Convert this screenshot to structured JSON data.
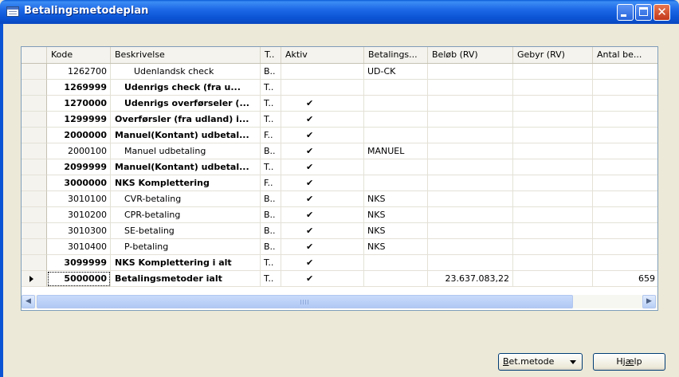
{
  "window": {
    "title": "Betalingsmetodeplan"
  },
  "grid": {
    "columns": [
      "Kode",
      "Beskrivelse",
      "T..",
      "Aktiv",
      "Betalings...",
      "Beløb (RV)",
      "Gebyr (RV)",
      "Antal be..."
    ],
    "rows": [
      {
        "kode": "1262700",
        "beskrivelse": "Udenlandsk check",
        "type": "B..",
        "aktiv": "",
        "betalings": "UD-CK",
        "belob": "",
        "gebyr": "",
        "antal": "",
        "bold": false,
        "indent": 2,
        "current": false
      },
      {
        "kode": "1269999",
        "beskrivelse": "Udenrigs check (fra u...",
        "type": "T..",
        "aktiv": "",
        "betalings": "",
        "belob": "",
        "gebyr": "",
        "antal": "",
        "bold": true,
        "indent": 1,
        "current": false
      },
      {
        "kode": "1270000",
        "beskrivelse": "Udenrigs overførseler (...",
        "type": "T..",
        "aktiv": "✔",
        "betalings": "",
        "belob": "",
        "gebyr": "",
        "antal": "",
        "bold": true,
        "indent": 1,
        "current": false
      },
      {
        "kode": "1299999",
        "beskrivelse": "Overførsler (fra udland) i...",
        "type": "T..",
        "aktiv": "✔",
        "betalings": "",
        "belob": "",
        "gebyr": "",
        "antal": "",
        "bold": true,
        "indent": 0,
        "current": false
      },
      {
        "kode": "2000000",
        "beskrivelse": "Manuel(Kontant) udbetal...",
        "type": "F..",
        "aktiv": "✔",
        "betalings": "",
        "belob": "",
        "gebyr": "",
        "antal": "",
        "bold": true,
        "indent": 0,
        "current": false
      },
      {
        "kode": "2000100",
        "beskrivelse": "Manuel udbetaling",
        "type": "B..",
        "aktiv": "✔",
        "betalings": "MANUEL",
        "belob": "",
        "gebyr": "",
        "antal": "",
        "bold": false,
        "indent": 1,
        "current": false
      },
      {
        "kode": "2099999",
        "beskrivelse": "Manuel(Kontant) udbetal...",
        "type": "T..",
        "aktiv": "✔",
        "betalings": "",
        "belob": "",
        "gebyr": "",
        "antal": "",
        "bold": true,
        "indent": 0,
        "current": false
      },
      {
        "kode": "3000000",
        "beskrivelse": "NKS Komplettering",
        "type": "F..",
        "aktiv": "✔",
        "betalings": "",
        "belob": "",
        "gebyr": "",
        "antal": "",
        "bold": true,
        "indent": 0,
        "current": false
      },
      {
        "kode": "3010100",
        "beskrivelse": "CVR-betaling",
        "type": "B..",
        "aktiv": "✔",
        "betalings": "NKS",
        "belob": "",
        "gebyr": "",
        "antal": "",
        "bold": false,
        "indent": 1,
        "current": false
      },
      {
        "kode": "3010200",
        "beskrivelse": "CPR-betaling",
        "type": "B..",
        "aktiv": "✔",
        "betalings": "NKS",
        "belob": "",
        "gebyr": "",
        "antal": "",
        "bold": false,
        "indent": 1,
        "current": false
      },
      {
        "kode": "3010300",
        "beskrivelse": "SE-betaling",
        "type": "B..",
        "aktiv": "✔",
        "betalings": "NKS",
        "belob": "",
        "gebyr": "",
        "antal": "",
        "bold": false,
        "indent": 1,
        "current": false
      },
      {
        "kode": "3010400",
        "beskrivelse": "P-betaling",
        "type": "B..",
        "aktiv": "✔",
        "betalings": "NKS",
        "belob": "",
        "gebyr": "",
        "antal": "",
        "bold": false,
        "indent": 1,
        "current": false
      },
      {
        "kode": "3099999",
        "beskrivelse": "NKS Komplettering i alt",
        "type": "T..",
        "aktiv": "✔",
        "betalings": "",
        "belob": "",
        "gebyr": "",
        "antal": "",
        "bold": true,
        "indent": 0,
        "current": false
      },
      {
        "kode": "5000000",
        "beskrivelse": "Betalingsmetoder ialt",
        "type": "T..",
        "aktiv": "✔",
        "betalings": "",
        "belob": "23.637.083,22",
        "gebyr": "",
        "antal": "659",
        "bold": true,
        "indent": 0,
        "current": true
      }
    ]
  },
  "buttons": {
    "bet_metode": {
      "label_underlined": "B",
      "label_rest": "et.metode"
    },
    "hjaelp": {
      "label_before": "Hj",
      "label_underlined": "æ",
      "label_after": "lp"
    }
  },
  "icons": {
    "title": "table-window-icon",
    "minimize": "minimize-icon",
    "maximize": "maximize-icon",
    "close": "close-icon",
    "scroll_up": "scroll-up-arrow-icon",
    "scroll_down": "scroll-down-arrow-icon",
    "scroll_left": "scroll-left-arrow-icon",
    "scroll_right": "scroll-right-arrow-icon",
    "dropdown": "chevron-down-icon",
    "row_pointer": "row-pointer-icon"
  }
}
